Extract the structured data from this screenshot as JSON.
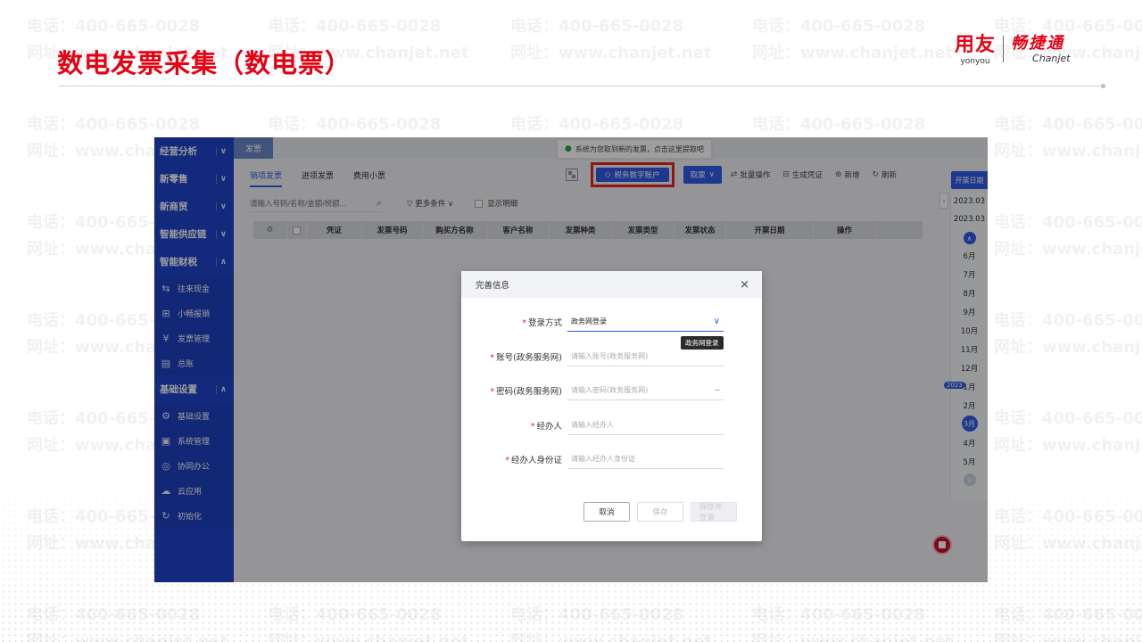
{
  "slide": {
    "title": "数电发票采集（数电票）",
    "watermark_phone": "电话：400-665-0028",
    "watermark_site": "网址：www.chanjet.net",
    "logo": {
      "yonyou_cn": "用友",
      "yonyou_en": "yonyou",
      "chanjet_cn": "畅捷通",
      "chanjet_en": "Chanjet"
    },
    "accent_color": "#e60012"
  },
  "app": {
    "sidebar": {
      "groups": [
        {
          "label": "经营分析",
          "expanded": false
        },
        {
          "label": "新零售",
          "expanded": false
        },
        {
          "label": "新商贸",
          "expanded": false
        },
        {
          "label": "智能供应链",
          "expanded": false
        },
        {
          "label": "智能财税",
          "expanded": true
        },
        {
          "label": "基础设置",
          "expanded": true
        }
      ],
      "finance_items": [
        {
          "label": "往来现金",
          "icon": "transfer-icon"
        },
        {
          "label": "小畅报销",
          "icon": "reimburse-icon"
        },
        {
          "label": "发票管理",
          "icon": "invoice-icon"
        },
        {
          "label": "总账",
          "icon": "ledger-icon"
        }
      ],
      "basic_items": [
        {
          "label": "基础设置",
          "icon": "settings-icon"
        },
        {
          "label": "系统管理",
          "icon": "system-icon"
        },
        {
          "label": "协同办公",
          "icon": "collab-icon"
        },
        {
          "label": "云应用",
          "icon": "cloud-icon"
        },
        {
          "label": "初始化",
          "icon": "init-icon"
        }
      ],
      "color": "#2044c8"
    },
    "top_tab": "发票",
    "toast": "系统为您取到新的发票，点击这里提取吧",
    "tabs": [
      "销项发票",
      "进项发票",
      "费用小票"
    ],
    "toolbar": {
      "tax_account": "税务数字账户",
      "take": "取票",
      "batch": "批量操作",
      "voucher": "生成凭证",
      "add": "新增",
      "refresh": "刷新"
    },
    "search_placeholder": "请输入号码/名称/金额/税额...",
    "more_conditions": "更多条件",
    "show_detail": "显示明细",
    "columns": [
      "凭证",
      "发票号码",
      "购买方名称",
      "客户名称",
      "发票种类",
      "发票类型",
      "发票状态",
      "开票日期",
      "操作"
    ],
    "date_panel": {
      "button": "开票日期",
      "range_start": "2023.03",
      "range_end": "2023.03",
      "months": [
        "6月",
        "7月",
        "8月",
        "9月",
        "10月",
        "11月",
        "12月",
        "1月",
        "2月",
        "3月",
        "4月",
        "5月"
      ],
      "current_month": "3月",
      "year_marker": "2023"
    },
    "primary_color": "#2f5be7"
  },
  "dialog": {
    "title": "完善信息",
    "fields": {
      "login_method": {
        "label": "登录方式",
        "value": "政务网登录"
      },
      "account": {
        "label": "账号(政务服务网)",
        "placeholder": "请输入账号(政务服务网)"
      },
      "password": {
        "label": "密码(政务服务网)",
        "placeholder": "请输入密码(政务服务网)"
      },
      "handler": {
        "label": "经办人",
        "placeholder": "请输入经办人"
      },
      "handler_id": {
        "label": "经办人身份证",
        "placeholder": "请输入经办人身份证"
      }
    },
    "tooltip": "政务网登录",
    "buttons": {
      "cancel": "取消",
      "save": "保存",
      "save_open": "保存并登录"
    }
  }
}
